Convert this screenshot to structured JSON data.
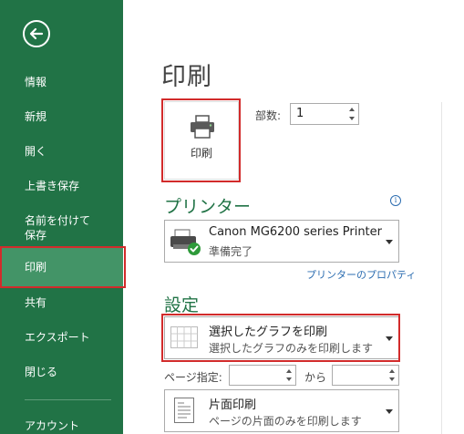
{
  "sidebar": {
    "items": [
      {
        "label": "情報"
      },
      {
        "label": "新規"
      },
      {
        "label": "開く"
      },
      {
        "label": "上書き保存"
      },
      {
        "label": "名前を付けて\n保存"
      },
      {
        "label": "印刷"
      },
      {
        "label": "共有"
      },
      {
        "label": "エクスポート"
      },
      {
        "label": "閉じる"
      },
      {
        "label": "アカウント"
      }
    ],
    "active": "印刷"
  },
  "main": {
    "title": "印刷",
    "print_button_label": "印刷",
    "copies_label": "部数:",
    "copies_value": "1",
    "printer_section": "プリンター",
    "printer_name": "Canon MG6200 series Printer",
    "printer_status": "準備完了",
    "printer_properties_link": "プリンターのプロパティ",
    "settings_section": "設定",
    "print_what_main": "選択したグラフを印刷",
    "print_what_sub": "選択したグラフのみを印刷します",
    "pages_label": "ページ指定:",
    "pages_from": "",
    "pages_to_label": "から",
    "pages_to": "",
    "sides_main": "片面印刷",
    "sides_sub": "ページの片面のみを印刷します"
  },
  "colors": {
    "brand": "#217346",
    "highlight": "#d22b2b",
    "link": "#2b6cb0"
  }
}
